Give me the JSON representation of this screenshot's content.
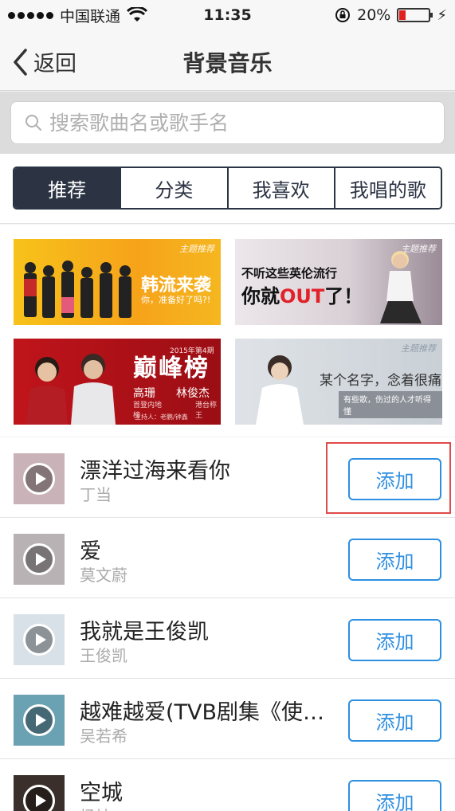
{
  "status_bar": {
    "carrier": "中国联通",
    "time": "11:35",
    "battery_percent": "20%",
    "battery_level": 0.2,
    "battery_color": "#e02020"
  },
  "nav": {
    "back_label": "返回",
    "title": "背景音乐"
  },
  "search": {
    "placeholder": "搜索歌曲名或歌手名",
    "value": ""
  },
  "tabs": [
    {
      "label": "推荐",
      "active": true
    },
    {
      "label": "分类",
      "active": false
    },
    {
      "label": "我喜欢",
      "active": false
    },
    {
      "label": "我唱的歌",
      "active": false
    }
  ],
  "banners": {
    "b1": {
      "tag": "主题推荐",
      "title": "韩流来袭",
      "subtitle": "你，准备好了吗?!"
    },
    "b2": {
      "tag": "主题推荐",
      "line1": "不听这些英伦流行",
      "line2_a": "你就",
      "line2_b": "OUT",
      "line2_c": "了！"
    },
    "b3": {
      "title": "巅峰榜",
      "date": "2015年第4期",
      "name1": "高珊",
      "name2": "林俊杰",
      "desc1": "首登内地榜",
      "desc2": "港台称王",
      "host": "主持人：老鹏/钟鑫"
    },
    "b4": {
      "tag": "主题推荐",
      "title": "某个名字，念着很痛",
      "subtitle": "有些歌，伤过的人才听得懂"
    }
  },
  "songs": [
    {
      "title": "漂洋过海来看你",
      "artist": "丁当",
      "button": "添加",
      "cover_color": "#c9b3b8"
    },
    {
      "title": "爱",
      "artist": "莫文蔚",
      "button": "添加",
      "cover_color": "#b9b2b4"
    },
    {
      "title": "我就是王俊凯",
      "artist": "王俊凯",
      "button": "添加",
      "cover_color": "#d9e1e8"
    },
    {
      "title": "越难越爱(TVB剧集《使徒行者》插曲)",
      "artist": "吴若希",
      "button": "添加",
      "cover_color": "#6aa2b3"
    },
    {
      "title": "空城",
      "artist": "杨坤",
      "button": "添加",
      "cover_color": "#3a2f2a"
    }
  ],
  "colors": {
    "accent": "#2f8fe0",
    "tab_dark": "#2c3444",
    "highlight": "#e04a4a"
  }
}
